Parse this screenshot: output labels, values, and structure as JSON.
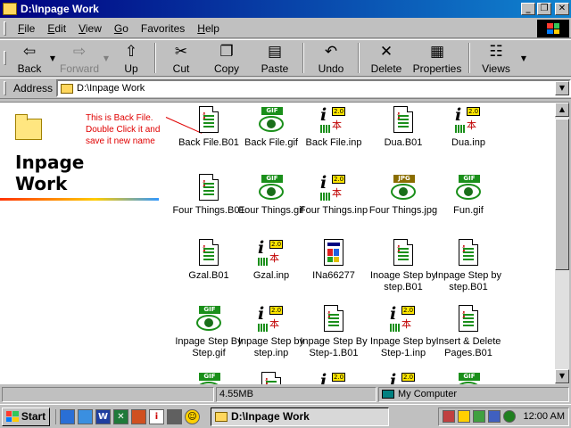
{
  "window": {
    "title": "D:\\Inpage Work"
  },
  "menubar": {
    "items": [
      {
        "ul": "F",
        "rest": "ile"
      },
      {
        "ul": "E",
        "rest": "dit"
      },
      {
        "ul": "V",
        "rest": "iew"
      },
      {
        "ul": "G",
        "rest": "o"
      },
      {
        "ul": "",
        "rest": "Favorites"
      },
      {
        "ul": "H",
        "rest": "elp"
      }
    ]
  },
  "toolbar": {
    "back": "Back",
    "forward": "Forward",
    "up": "Up",
    "cut": "Cut",
    "copy": "Copy",
    "paste": "Paste",
    "undo": "Undo",
    "delete": "Delete",
    "properties": "Properties",
    "views": "Views"
  },
  "address": {
    "label": "Address",
    "value": "D:\\Inpage Work"
  },
  "folder": {
    "title_line1": "Inpage",
    "title_line2": "Work",
    "annotation": "This is Back File. Double Click it and save it new name"
  },
  "files": [
    {
      "name": "Back File.B01",
      "type": "doc"
    },
    {
      "name": "Back File.gif",
      "type": "gif"
    },
    {
      "name": "Back File.inp",
      "type": "inp"
    },
    {
      "name": "Dua.B01",
      "type": "doc"
    },
    {
      "name": "Dua.inp",
      "type": "inp"
    },
    {
      "name": "Four Things.B01",
      "type": "doc"
    },
    {
      "name": "Four Things.gif",
      "type": "gif"
    },
    {
      "name": "Four Things.inp",
      "type": "inp"
    },
    {
      "name": "Four Things.jpg",
      "type": "jpg"
    },
    {
      "name": "Fun.gif",
      "type": "gif"
    },
    {
      "name": "Gzal.B01",
      "type": "doc"
    },
    {
      "name": "Gzal.inp",
      "type": "inp"
    },
    {
      "name": "INa66277",
      "type": "exe"
    },
    {
      "name": "Inoage Step by step.B01",
      "type": "doc"
    },
    {
      "name": "Inpage Step by step.B01",
      "type": "doc"
    },
    {
      "name": "Inpage Step By Step.gif",
      "type": "gif"
    },
    {
      "name": "Inpage Step by step.inp",
      "type": "inp"
    },
    {
      "name": "Inpage Step By Step-1.B01",
      "type": "doc"
    },
    {
      "name": "Inpage Step by Step-1.inp",
      "type": "inp"
    },
    {
      "name": "Insert & Delete Pages.B01",
      "type": "doc"
    },
    {
      "name": "",
      "type": "gif"
    },
    {
      "name": "",
      "type": "doc"
    },
    {
      "name": "",
      "type": "inp"
    },
    {
      "name": "",
      "type": "inp"
    },
    {
      "name": "",
      "type": "gif"
    }
  ],
  "status": {
    "size": "4.55MB",
    "zone": "My Computer"
  },
  "icon_badges": {
    "gif": "GIF",
    "jpg": "JPG",
    "inp": "2.0",
    "inp_letter": "i",
    "kanji": "本"
  },
  "taskbar": {
    "start": "Start",
    "task": "D:\\Inpage Work",
    "clock": "12:00 AM",
    "ql_word": "W"
  }
}
